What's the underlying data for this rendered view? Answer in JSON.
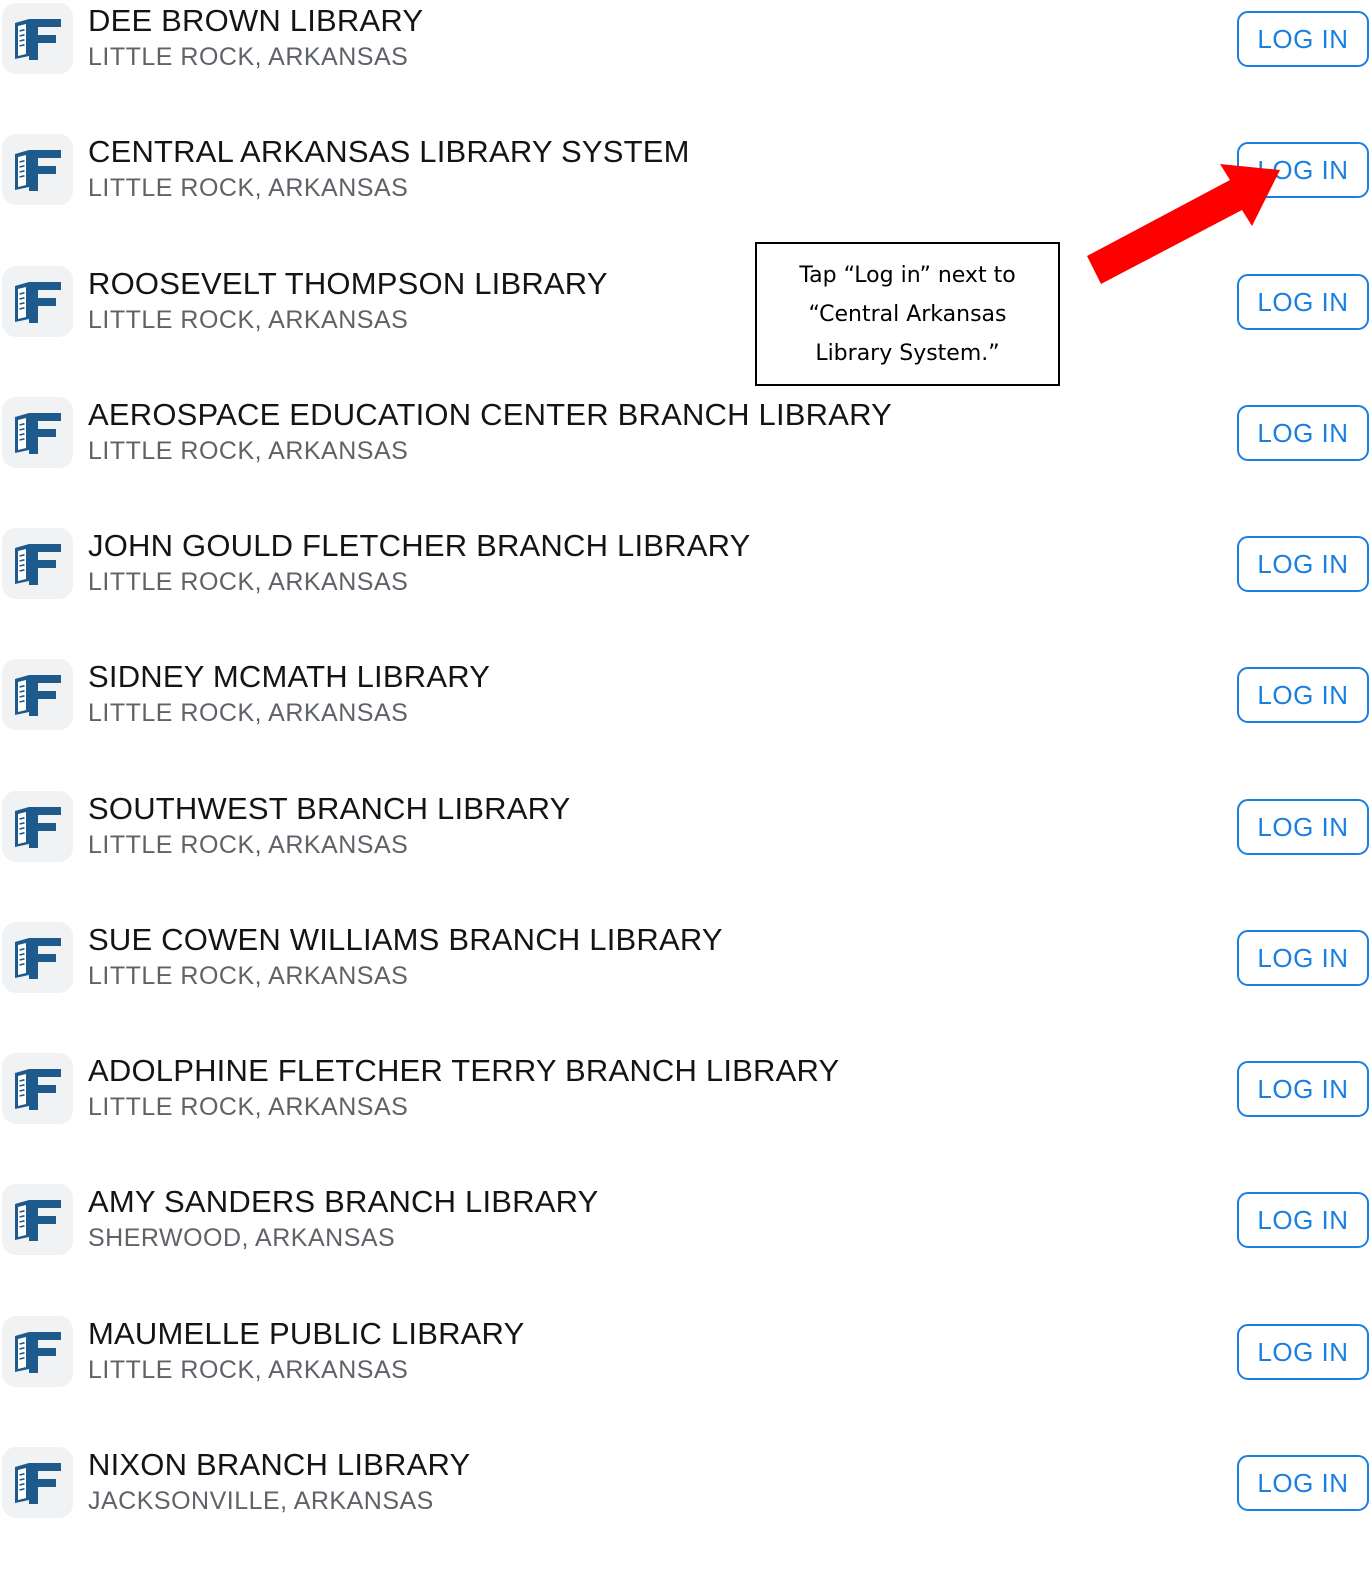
{
  "button_label": "LOG IN",
  "libraries": [
    {
      "name": "DEE BROWN LIBRARY",
      "location": "LITTLE ROCK, ARKANSAS"
    },
    {
      "name": "CENTRAL ARKANSAS LIBRARY SYSTEM",
      "location": "LITTLE ROCK, ARKANSAS"
    },
    {
      "name": "ROOSEVELT THOMPSON LIBRARY",
      "location": "LITTLE ROCK, ARKANSAS"
    },
    {
      "name": "AEROSPACE EDUCATION CENTER BRANCH LIBRARY",
      "location": "LITTLE ROCK, ARKANSAS"
    },
    {
      "name": "JOHN GOULD FLETCHER BRANCH LIBRARY",
      "location": "LITTLE ROCK, ARKANSAS"
    },
    {
      "name": "SIDNEY MCMATH LIBRARY",
      "location": "LITTLE ROCK, ARKANSAS"
    },
    {
      "name": "SOUTHWEST BRANCH LIBRARY",
      "location": "LITTLE ROCK, ARKANSAS"
    },
    {
      "name": "SUE COWEN WILLIAMS BRANCH LIBRARY",
      "location": "LITTLE ROCK, ARKANSAS"
    },
    {
      "name": "ADOLPHINE FLETCHER TERRY BRANCH LIBRARY",
      "location": "LITTLE ROCK, ARKANSAS"
    },
    {
      "name": "AMY SANDERS BRANCH LIBRARY",
      "location": "SHERWOOD, ARKANSAS"
    },
    {
      "name": "MAUMELLE PUBLIC LIBRARY",
      "location": "LITTLE ROCK, ARKANSAS"
    },
    {
      "name": "NIXON BRANCH LIBRARY",
      "location": "JACKSONVILLE, ARKANSAS"
    }
  ],
  "annotation": {
    "text": "Tap “Log in” next to “Central Arkansas Library System.”"
  },
  "colors": {
    "accent": "#1b7fe0",
    "icon_blue": "#1e5a8c",
    "arrow": "#ff0000"
  }
}
